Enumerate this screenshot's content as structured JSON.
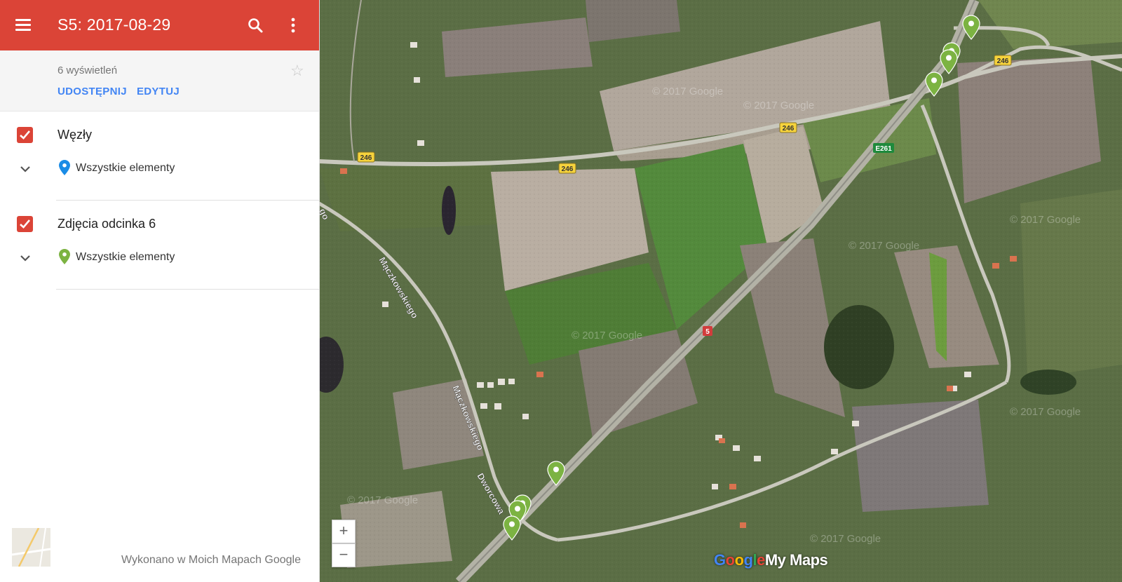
{
  "header": {
    "title": "S5: 2017-08-29",
    "menu_icon": "menu-icon",
    "search_icon": "search-icon",
    "more_icon": "more-vert-icon",
    "color": "#db4437"
  },
  "info": {
    "views": "6 wyświetleń",
    "share_label": "UDOSTĘPNIJ",
    "edit_label": "EDYTUJ",
    "star_icon": "star-icon"
  },
  "layers": [
    {
      "name": "Węzły",
      "checked": true,
      "items_label": "Wszystkie elementy",
      "pin_color": "#1a8ce6"
    },
    {
      "name": "Zdjęcia odcinka 6",
      "checked": true,
      "items_label": "Wszystkie elementy",
      "pin_color": "#7cb342"
    }
  ],
  "footer": {
    "text": "Wykonano w Moich Mapach Google"
  },
  "map": {
    "road_labels": {
      "r246": "246",
      "e261": "E261",
      "s5": "5"
    },
    "street_labels": {
      "maczkowskiego": "Mączkowskiego",
      "dworcowa": "Dworcowa",
      "cut": "go"
    },
    "watermark": "© 2017 Google",
    "zoom_in": "+",
    "zoom_out": "−",
    "brand_google": [
      "G",
      "o",
      "o",
      "g",
      "l",
      "e"
    ],
    "brand_mymaps": "My Maps",
    "marker_color": "#7cb342"
  }
}
